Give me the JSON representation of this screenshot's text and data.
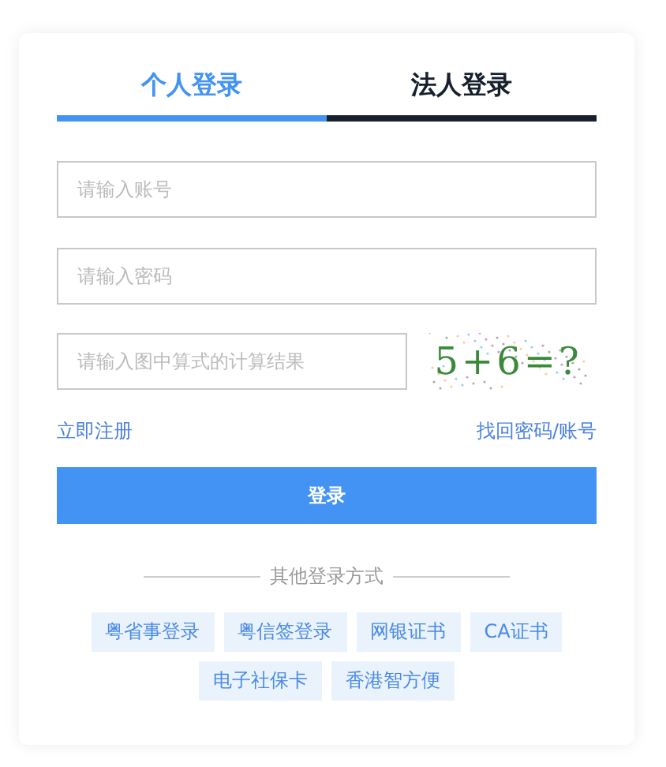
{
  "tabs": [
    {
      "label": "个人登录",
      "selected": true
    },
    {
      "label": "法人登录",
      "selected": false
    }
  ],
  "fields": [
    {
      "placeholder": "请输入账号"
    },
    {
      "placeholder": "请输入密码"
    }
  ],
  "captcha": {
    "placeholder": "请输入图中算式的计算结果",
    "image_text": "5+6=?"
  },
  "links": {
    "register": "立即注册",
    "recover": "找回密码/账号"
  },
  "login_button": "登录",
  "other_title": "其他登录方式",
  "other_methods": [
    "粤省事登录",
    "粤信签登录",
    "网银证书",
    "CA证书",
    "电子社保卡",
    "香港智方便"
  ]
}
